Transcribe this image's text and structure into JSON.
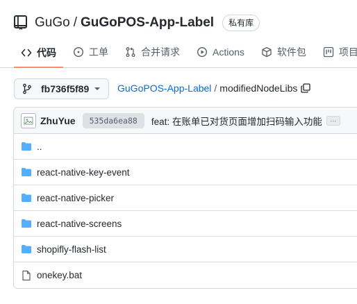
{
  "repo": {
    "owner": "GuGo",
    "separator": "/",
    "name": "GuGoPOS-App-Label",
    "visibility": "私有库"
  },
  "tabs": [
    {
      "label": "代码",
      "icon": "code-icon",
      "active": true
    },
    {
      "label": "工单",
      "icon": "issue-icon",
      "active": false
    },
    {
      "label": "合并请求",
      "icon": "pull-request-icon",
      "active": false
    },
    {
      "label": "Actions",
      "icon": "play-icon",
      "active": false
    },
    {
      "label": "软件包",
      "icon": "package-icon",
      "active": false
    },
    {
      "label": "项目",
      "icon": "project-icon",
      "active": false
    }
  ],
  "branch": {
    "name": "fb736f5f89",
    "icon": "git-branch-icon"
  },
  "breadcrumb": {
    "repo_link": "GuGoPOS-App-Label",
    "separator": "/",
    "current": "modifiedNodeLibs"
  },
  "commit": {
    "author": "ZhuYue",
    "sha": "535da6ea88",
    "message": "feat: 在账单已对货页面增加扫码输入功能",
    "more": "···"
  },
  "files": [
    {
      "name": "..",
      "type": "folder"
    },
    {
      "name": "react-native-key-event",
      "type": "folder"
    },
    {
      "name": "react-native-picker",
      "type": "folder"
    },
    {
      "name": "react-native-screens",
      "type": "folder"
    },
    {
      "name": "shopifly-flash-list",
      "type": "folder"
    },
    {
      "name": "onekey.bat",
      "type": "file"
    }
  ],
  "colors": {
    "link": "#0969da",
    "folder": "#54aeff",
    "active_tab_underline": "#fd8c73",
    "text": "#24292f",
    "muted": "#57606a",
    "border": "#d0d7de"
  }
}
